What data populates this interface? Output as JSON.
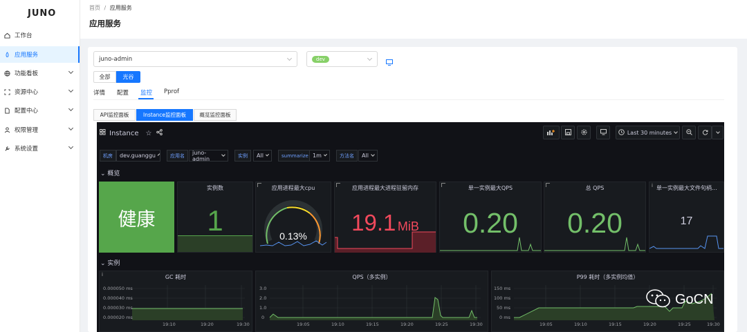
{
  "app": {
    "logo": "JUNO"
  },
  "sidebar": {
    "items": [
      {
        "label": "工作台",
        "icon": "home-icon",
        "expandable": false,
        "active": false
      },
      {
        "label": "应用服务",
        "icon": "rocket-icon",
        "expandable": false,
        "active": true
      },
      {
        "label": "功能看板",
        "icon": "globe-icon",
        "expandable": true,
        "active": false
      },
      {
        "label": "资源中心",
        "icon": "scan-icon",
        "expandable": true,
        "active": false
      },
      {
        "label": "配置中心",
        "icon": "file-icon",
        "expandable": true,
        "active": false
      },
      {
        "label": "权限管理",
        "icon": "user-icon",
        "expandable": true,
        "active": false
      },
      {
        "label": "系统设置",
        "icon": "wrench-icon",
        "expandable": true,
        "active": false
      }
    ]
  },
  "header": {
    "breadcrumb": [
      "首页",
      "/",
      "应用服务"
    ],
    "title": "应用服务"
  },
  "app_select": {
    "value": "juno-admin"
  },
  "env_select": {
    "value": "dev"
  },
  "zone_buttons": [
    "全部",
    "光谷"
  ],
  "zone_selected": "光谷",
  "tabs": [
    "详情",
    "配置",
    "监控",
    "Pprof"
  ],
  "tabs_active": "监控",
  "dashboard_tabs": [
    "API监控面板",
    "Instance监控面板",
    "概览监控面板"
  ],
  "dashboard_tabs_active": "Instance监控面板",
  "grafana": {
    "title": "Instance",
    "time_range": "Last 30 minutes",
    "variables": [
      {
        "label": "机房",
        "value": "dev.guanggu"
      },
      {
        "label": "应用名",
        "value": "juno-admin"
      },
      {
        "label": "实例",
        "value": "All"
      },
      {
        "label": "summarize",
        "value": "1m"
      },
      {
        "label": "方法名",
        "value": "All"
      }
    ],
    "rows": [
      "概览",
      "实例"
    ],
    "stats": [
      {
        "title": "",
        "value": "健康",
        "bg": "#56a64b",
        "color": "#ffffff"
      },
      {
        "title": "实例数",
        "value": "1",
        "color": "#56a64b"
      },
      {
        "title": "应用进程最大cpu",
        "value": "0.13%",
        "gauge_fraction": 0.0013
      },
      {
        "title": "应用进程最大进程驻留内存",
        "value": "19.1",
        "unit": "MiB",
        "color": "#f2495c"
      },
      {
        "title": "单一实例最大QPS",
        "value": "0.20",
        "color": "#73bf69"
      },
      {
        "title": "总 QPS",
        "value": "0.20",
        "color": "#73bf69"
      },
      {
        "title": "单一实例最大文件句柄...",
        "value": "17",
        "color": "#ccccdc"
      }
    ],
    "timeseries": [
      {
        "title": "GC 耗时",
        "yticks": [
          "0.000050 ms",
          "0.000040 ms",
          "0.000030 ms",
          "0.000020 ms"
        ],
        "xticks": [
          "19:10",
          "19:20",
          "19:30"
        ]
      },
      {
        "title": "QPS（多实例）",
        "yticks": [
          "3.0",
          "2.0",
          "1.0",
          "0"
        ],
        "xticks": [
          "19:05",
          "19:10",
          "19:15",
          "19:20",
          "19:25",
          "19:30"
        ]
      },
      {
        "title": "P99 耗时（多实例均值）",
        "yticks": [
          "150 ms",
          "100 ms",
          "50 ms",
          "0 ms"
        ],
        "xticks": [
          "19:05",
          "19:10",
          "19:15",
          "19:20",
          "19:25",
          "19:30"
        ]
      }
    ]
  },
  "watermark": {
    "text": "GoCN"
  }
}
